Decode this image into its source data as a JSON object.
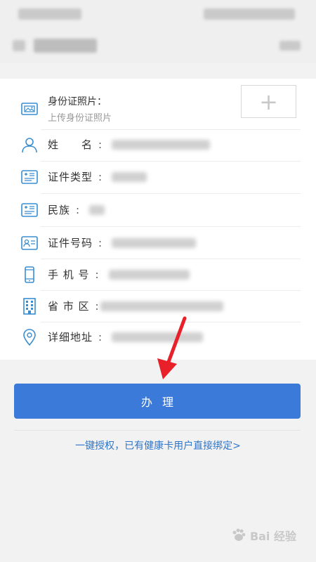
{
  "form": {
    "photo": {
      "label": "身份证照片：",
      "hint": "上传身份证照片",
      "upload_symbol": "+"
    },
    "rows": [
      {
        "label": "姓　　名",
        "icon": "person-icon"
      },
      {
        "label": "证件类型",
        "icon": "id-card-icon"
      },
      {
        "label": "民族",
        "icon": "id-card-icon"
      },
      {
        "label": "证件号码",
        "icon": "id-photo-icon"
      },
      {
        "label": "手 机 号",
        "icon": "phone-icon"
      },
      {
        "label": "省 市 区",
        "icon": "building-icon"
      },
      {
        "label": "详细地址",
        "icon": "location-icon"
      }
    ],
    "colon": ":"
  },
  "submit": {
    "label": "办理"
  },
  "bind_link": {
    "text": "一键授权，已有健康卡用户直接绑定>"
  },
  "watermark": {
    "text": "Bai 经验"
  },
  "colors": {
    "accent": "#3b7ad8",
    "link": "#2f76c9",
    "icon": "#3a8ed0",
    "arrow": "#e8202a"
  }
}
